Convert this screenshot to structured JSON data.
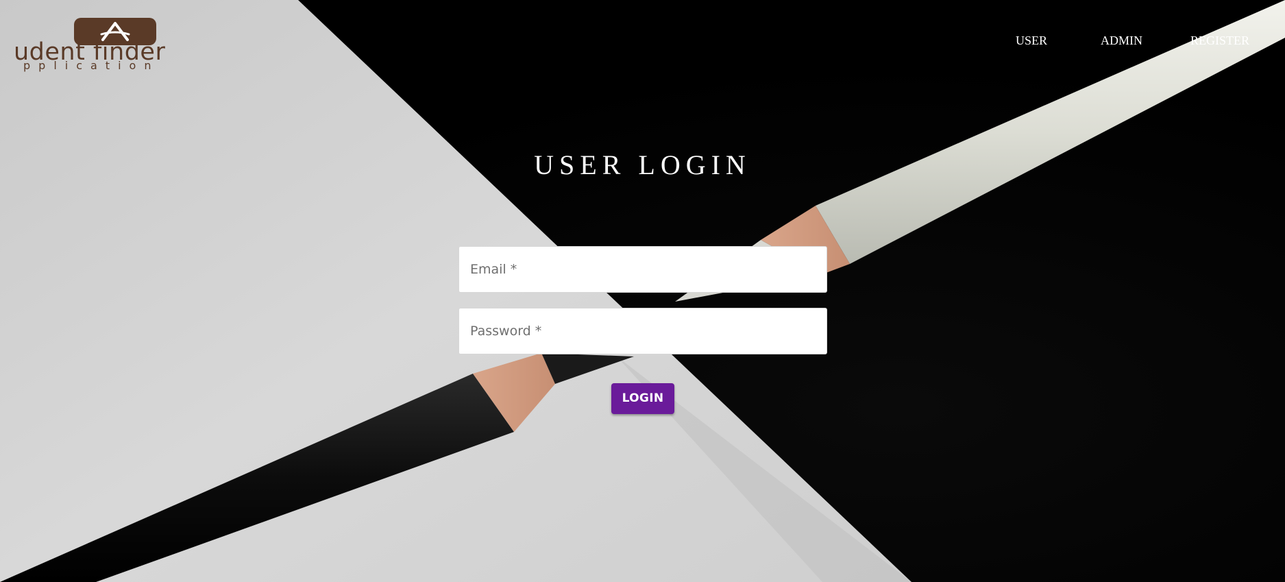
{
  "logo": {
    "icon": "A",
    "main_text": "udent finder",
    "sub_text": "pplication"
  },
  "nav": {
    "items": [
      {
        "label": "USER"
      },
      {
        "label": "ADMIN"
      },
      {
        "label": "REGISTER"
      }
    ]
  },
  "login": {
    "title": "USER LOGIN",
    "email_placeholder": "Email *",
    "password_placeholder": "Password *",
    "button_label": "LOGIN"
  },
  "colors": {
    "logo_brown": "#5a3a27",
    "button_purple": "#6a1b9a",
    "nav_text": "#ffffff"
  }
}
